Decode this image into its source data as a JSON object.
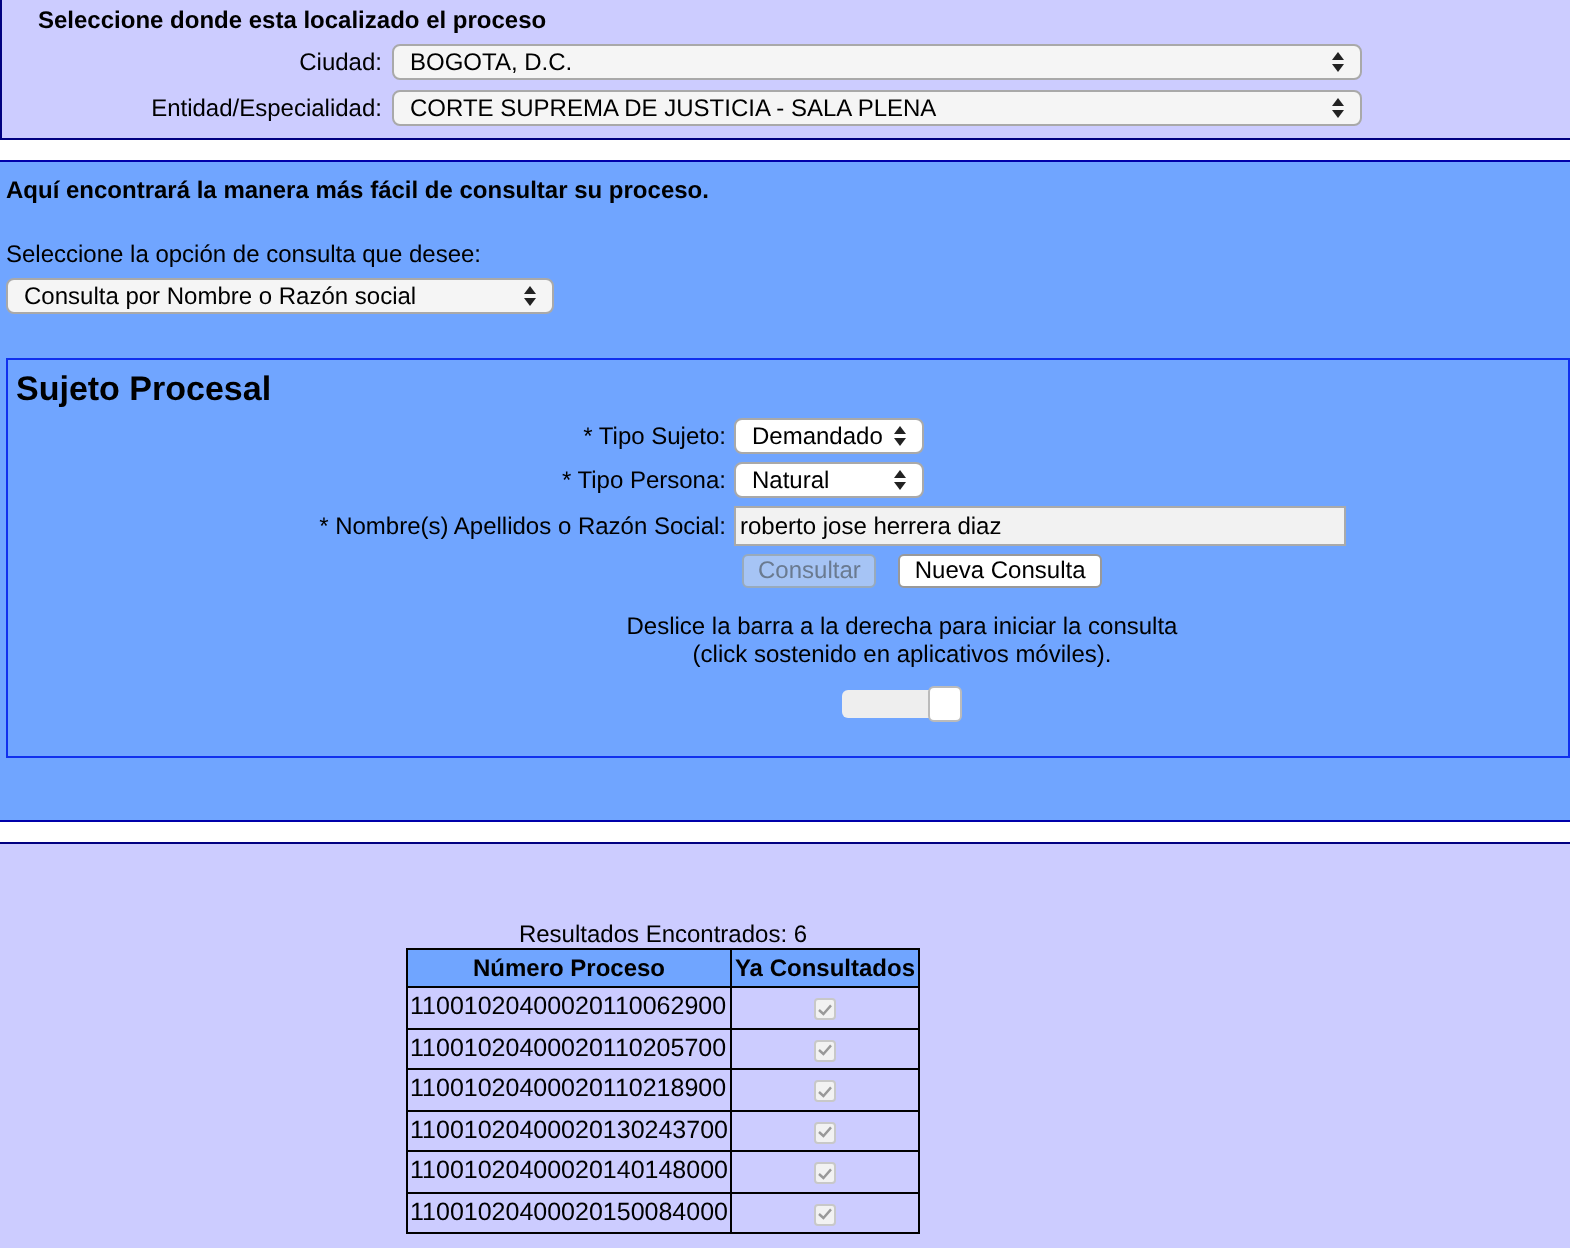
{
  "location": {
    "heading": "Seleccione donde esta localizado el proceso",
    "fields": [
      {
        "label": "Ciudad:",
        "value": "BOGOTA, D.C."
      },
      {
        "label": "Entidad/Especialidad:",
        "value": "CORTE SUPREMA DE JUSTICIA - SALA PLENA"
      }
    ]
  },
  "query": {
    "heading": "Aquí encontrará la manera más fácil de consultar su proceso.",
    "option_label": "Seleccione la opción de consulta que desee:",
    "option_value": "Consulta por Nombre o Razón social"
  },
  "subject": {
    "title": "Sujeto Procesal",
    "tipo_sujeto": {
      "label": "* Tipo Sujeto:",
      "value": "Demandado"
    },
    "tipo_persona": {
      "label": "* Tipo Persona:",
      "value": "Natural"
    },
    "nombre": {
      "label": "* Nombre(s) Apellidos o Razón Social:",
      "value": "roberto jose herrera diaz"
    },
    "buttons": [
      {
        "label": "Consultar",
        "disabled": true
      },
      {
        "label": "Nueva Consulta",
        "disabled": false
      }
    ],
    "slider_hint": [
      "Deslice la barra a la derecha para iniciar la consulta",
      "(click sostenido en aplicativos móviles)."
    ],
    "slider": {
      "level": 1
    }
  },
  "results": {
    "caption": "Resultados Encontrados: 6",
    "columns": [
      "Número Proceso",
      "Ya Consultados"
    ],
    "rows": [
      {
        "number": "11001020400020110062900",
        "checked": true
      },
      {
        "number": "11001020400020110205700",
        "checked": true
      },
      {
        "number": "11001020400020110218900",
        "checked": true
      },
      {
        "number": "11001020400020130243700",
        "checked": true
      },
      {
        "number": "11001020400020140148000",
        "checked": true
      },
      {
        "number": "11001020400020150084000",
        "checked": true
      }
    ]
  }
}
